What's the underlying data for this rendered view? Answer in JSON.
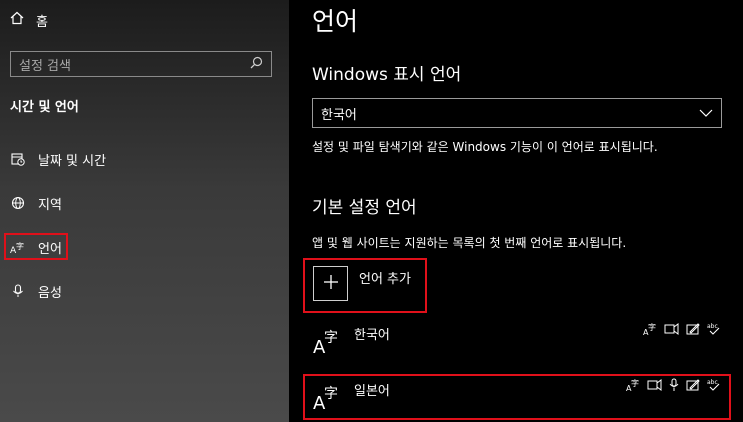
{
  "sidebar": {
    "home_label": "홈",
    "search_placeholder": "설정 검색",
    "section_title": "시간 및 언어",
    "items": [
      {
        "label": "날짜 및 시간",
        "icon": "calendar-clock-icon"
      },
      {
        "label": "지역",
        "icon": "globe-icon"
      },
      {
        "label": "언어",
        "icon": "language-icon",
        "highlighted": true
      },
      {
        "label": "음성",
        "icon": "microphone-icon"
      }
    ]
  },
  "main": {
    "title": "언어",
    "display_language": {
      "heading": "Windows 표시 언어",
      "selected": "한국어",
      "description": "설정 및 파일 탐색기와 같은 Windows 기능이 이 언어로 표시됩니다."
    },
    "preferred_languages": {
      "heading": "기본 설정 언어",
      "description": "앱 및 웹 사이트는 지원하는 목록의 첫 번째 언어로 표시됩니다.",
      "add_label": "언어 추가",
      "languages": [
        {
          "name": "한국어",
          "features": [
            "display-language-icon",
            "text-to-speech-icon",
            "handwriting-icon",
            "spell-check-icon"
          ]
        },
        {
          "name": "일본어",
          "features": [
            "display-language-icon",
            "text-to-speech-icon",
            "speech-recognition-icon",
            "handwriting-icon",
            "spell-check-icon"
          ],
          "highlighted": true
        }
      ]
    }
  },
  "colors": {
    "highlight": "#e0101a",
    "background": "#000000"
  }
}
